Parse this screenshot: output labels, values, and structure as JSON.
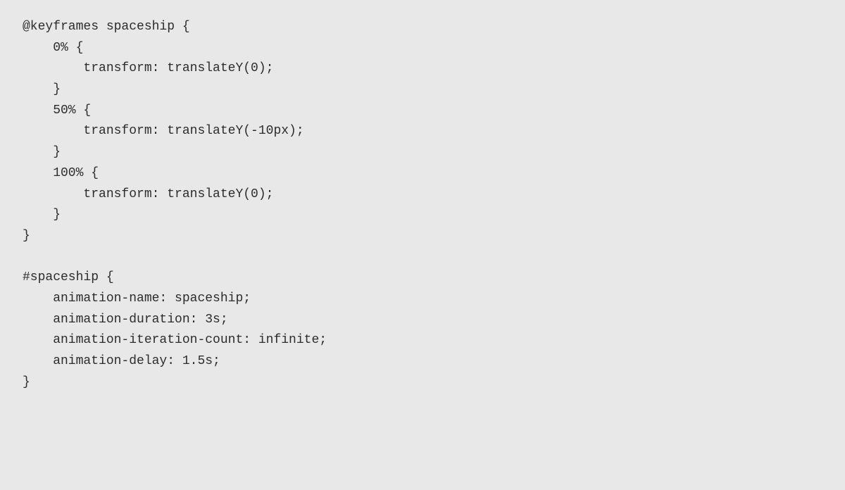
{
  "code": {
    "lines": [
      {
        "indent": 0,
        "text": "@keyframes spaceship {"
      },
      {
        "indent": 1,
        "text": "0% {"
      },
      {
        "indent": 2,
        "text": "transform: translateY(0);"
      },
      {
        "indent": 1,
        "text": "}"
      },
      {
        "indent": 1,
        "text": "50% {"
      },
      {
        "indent": 2,
        "text": "transform: translateY(-10px);"
      },
      {
        "indent": 1,
        "text": "}"
      },
      {
        "indent": 1,
        "text": "100% {"
      },
      {
        "indent": 2,
        "text": "transform: translateY(0);"
      },
      {
        "indent": 1,
        "text": "}"
      },
      {
        "indent": 0,
        "text": "}"
      },
      {
        "indent": -1,
        "text": ""
      },
      {
        "indent": 0,
        "text": "#spaceship {"
      },
      {
        "indent": 1,
        "text": "animation-name: spaceship;"
      },
      {
        "indent": 1,
        "text": "animation-duration: 3s;"
      },
      {
        "indent": 1,
        "text": "animation-iteration-count: infinite;"
      },
      {
        "indent": 1,
        "text": "animation-delay: 1.5s;"
      },
      {
        "indent": 0,
        "text": "}"
      }
    ]
  }
}
